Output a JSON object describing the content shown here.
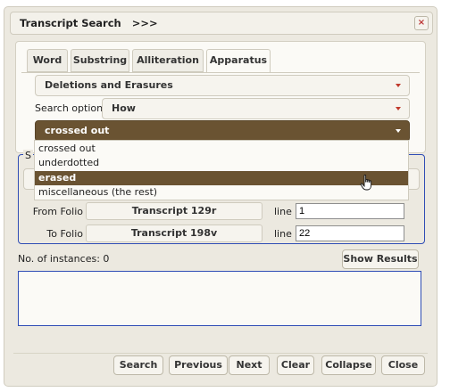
{
  "titlebar": {
    "title": "Transcript Search   >>>",
    "close": "×"
  },
  "tabs": [
    {
      "label": "Word",
      "active": false
    },
    {
      "label": "Substring",
      "active": false
    },
    {
      "label": "Alliteration",
      "active": false
    },
    {
      "label": "Apparatus",
      "active": true
    }
  ],
  "apparatus": {
    "category_selected": "Deletions and Erasures",
    "search_options_label": "Search options:",
    "search_options_selected": "How",
    "how_selected": "crossed out",
    "how_options": [
      "crossed out",
      "underdotted",
      "erased",
      "miscellaneous (the rest)"
    ],
    "highlighted_option": "erased"
  },
  "range": {
    "legend_fragment": "S",
    "from_label": "From Folio",
    "from_folio": "Transcript 129r",
    "from_line_label": "line",
    "from_line_value": "1",
    "to_label": "To Folio",
    "to_folio": "Transcript 198v",
    "to_line_label": "line",
    "to_line_value": "22"
  },
  "results": {
    "instances_label": "No. of instances: 0",
    "show_results_label": "Show Results"
  },
  "footer": {
    "search": "Search",
    "previous": "Previous",
    "next": "Next",
    "clear": "Clear",
    "collapse": "Collapse",
    "close": "Close"
  },
  "colors": {
    "accent_brown": "#6a5332",
    "panel_bg": "#ece9e0",
    "fieldset_border": "#2f4db5",
    "caret_red": "#c0392b"
  }
}
